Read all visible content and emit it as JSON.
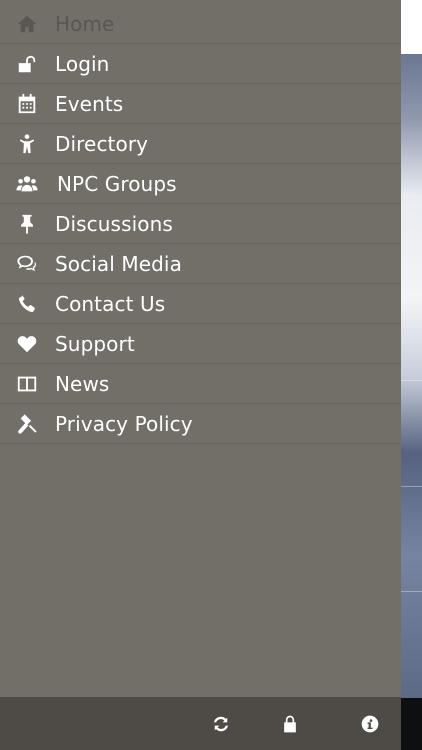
{
  "menu": {
    "items": [
      {
        "label": "Home",
        "icon": "home-icon",
        "active": true
      },
      {
        "label": "Login",
        "icon": "unlock-icon"
      },
      {
        "label": "Events",
        "icon": "calendar-icon"
      },
      {
        "label": "Directory",
        "icon": "person-icon"
      },
      {
        "label": "NPC Groups",
        "icon": "users-icon"
      },
      {
        "label": "Discussions",
        "icon": "pushpin-icon"
      },
      {
        "label": "Social Media",
        "icon": "chat-bubbles-icon"
      },
      {
        "label": "Contact Us",
        "icon": "phone-icon"
      },
      {
        "label": "Support",
        "icon": "heart-icon"
      },
      {
        "label": "News",
        "icon": "book-icon"
      },
      {
        "label": "Privacy Policy",
        "icon": "gavel-icon"
      }
    ]
  },
  "footer": {
    "buttons": [
      "refresh-icon",
      "lock-icon",
      "info-icon"
    ]
  },
  "colors": {
    "drawer_bg": "#726e68",
    "footer_bg": "#4e4b47",
    "active_text": "#5a5651",
    "text": "#ffffff"
  }
}
